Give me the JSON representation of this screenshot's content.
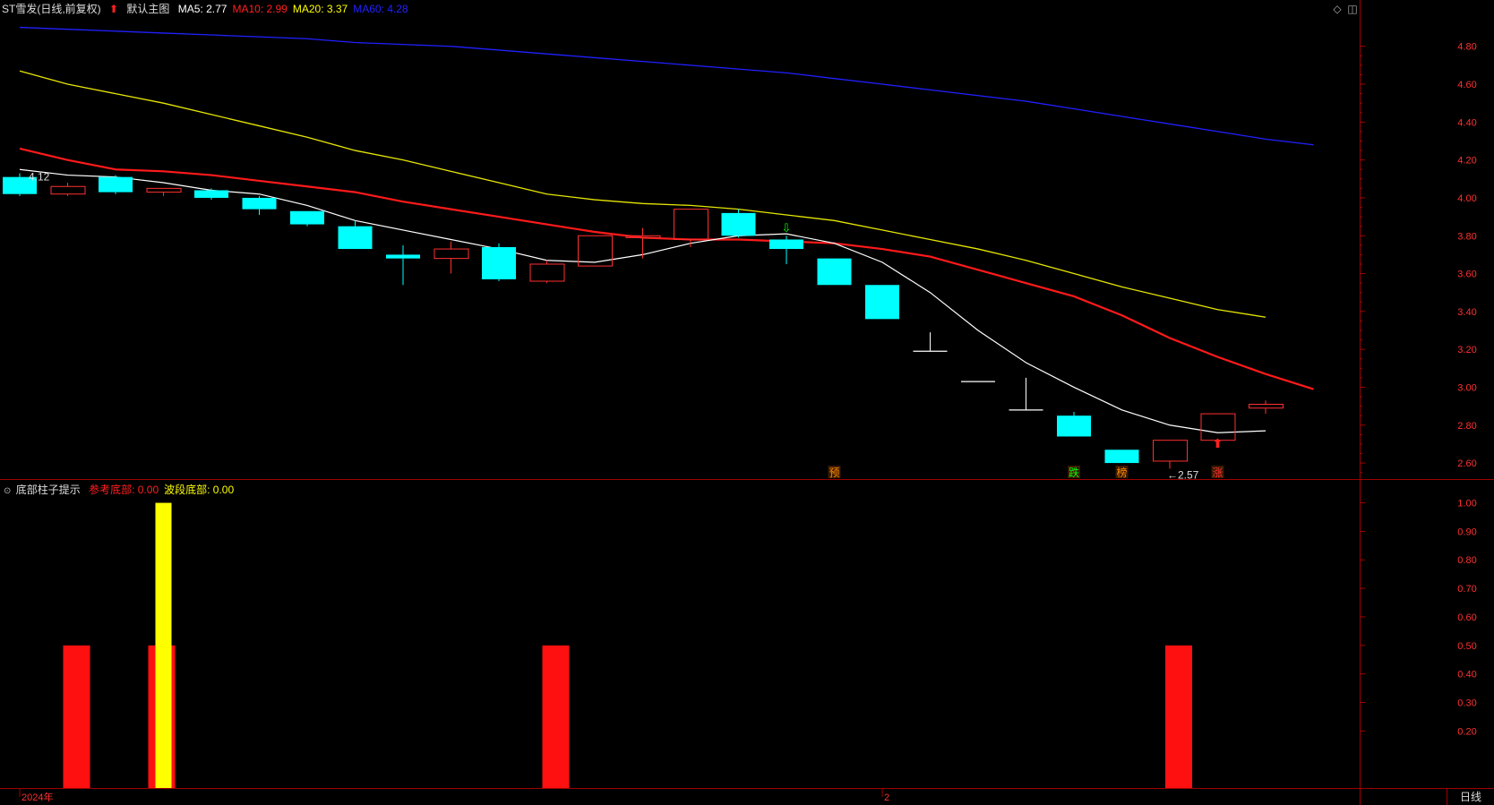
{
  "header": {
    "stock": "ST雪发",
    "adjust": "(日线,前复权)",
    "template": "默认主图",
    "ma": [
      {
        "label": "MA5:",
        "value": "2.77",
        "color": "#ffffff"
      },
      {
        "label": "MA10:",
        "value": "2.99",
        "color": "#ff2020"
      },
      {
        "label": "MA20:",
        "value": "3.37",
        "color": "#ffff00"
      },
      {
        "label": "MA60:",
        "value": "4.28",
        "color": "#2222ff"
      }
    ]
  },
  "indicator": {
    "name": "底部柱子提示",
    "items": [
      {
        "label": "参考底部:",
        "value": "0.00",
        "color": "#ff2020"
      },
      {
        "label": "波段底部:",
        "value": "0.00",
        "color": "#ffff00"
      }
    ]
  },
  "colors": {
    "up": "#ff3030",
    "down": "#00ffff",
    "axis": "#a00000",
    "ma5": "#ffffff",
    "ma10": "#ff1a1a",
    "ma20": "#e6e600",
    "ma60": "#2020ff"
  },
  "axis": {
    "price_ticks": [
      "4.80",
      "4.60",
      "4.40",
      "4.20",
      "4.00",
      "3.80",
      "3.60",
      "3.40",
      "3.20",
      "3.00",
      "2.80",
      "2.60"
    ],
    "ind_ticks": [
      "1.00",
      "0.90",
      "0.80",
      "0.70",
      "0.60",
      "0.50",
      "0.40",
      "0.30",
      "0.20"
    ],
    "date_labels": [
      {
        "text": "2024年",
        "index": 0
      },
      {
        "text": "2",
        "index": 18
      }
    ],
    "period": "日线"
  },
  "markers": {
    "high_label": "4.12",
    "low_label": "←2.57",
    "signals": [
      {
        "text": "预",
        "index": 17,
        "color": "#ff8c00"
      },
      {
        "text": "跌",
        "index": 22,
        "color": "#00ff00"
      },
      {
        "text": "榜",
        "index": 23,
        "color": "#ff8c00"
      },
      {
        "text": "涨",
        "index": 25,
        "color": "#ff3030"
      }
    ]
  },
  "chart_data": {
    "type": "candlestick",
    "candles": [
      {
        "o": 4.11,
        "h": 4.13,
        "l": 4.01,
        "c": 4.02
      },
      {
        "o": 4.02,
        "h": 4.08,
        "l": 4.01,
        "c": 4.06
      },
      {
        "o": 4.11,
        "h": 4.12,
        "l": 4.02,
        "c": 4.03
      },
      {
        "o": 4.03,
        "h": 4.05,
        "l": 4.01,
        "c": 4.05
      },
      {
        "o": 4.04,
        "h": 4.05,
        "l": 3.99,
        "c": 4.0
      },
      {
        "o": 4.0,
        "h": 4.01,
        "l": 3.91,
        "c": 3.94
      },
      {
        "o": 3.93,
        "h": 3.93,
        "l": 3.85,
        "c": 3.86
      },
      {
        "o": 3.85,
        "h": 3.88,
        "l": 3.73,
        "c": 3.73
      },
      {
        "o": 3.7,
        "h": 3.75,
        "l": 3.54,
        "c": 3.68
      },
      {
        "o": 3.68,
        "h": 3.77,
        "l": 3.6,
        "c": 3.73
      },
      {
        "o": 3.74,
        "h": 3.76,
        "l": 3.56,
        "c": 3.57
      },
      {
        "o": 3.56,
        "h": 3.67,
        "l": 3.55,
        "c": 3.65
      },
      {
        "o": 3.64,
        "h": 3.8,
        "l": 3.64,
        "c": 3.8
      },
      {
        "o": 3.79,
        "h": 3.84,
        "l": 3.68,
        "c": 3.8
      },
      {
        "o": 3.78,
        "h": 3.94,
        "l": 3.74,
        "c": 3.94
      },
      {
        "o": 3.92,
        "h": 3.94,
        "l": 3.79,
        "c": 3.8
      },
      {
        "o": 3.78,
        "h": 3.8,
        "l": 3.65,
        "c": 3.73
      },
      {
        "o": 3.68,
        "h": 3.68,
        "l": 3.54,
        "c": 3.54
      },
      {
        "o": 3.54,
        "h": 3.54,
        "l": 3.36,
        "c": 3.36
      },
      {
        "o": 3.19,
        "h": 3.29,
        "l": 3.19,
        "c": 3.19
      },
      {
        "o": 3.03,
        "h": 3.03,
        "l": 3.03,
        "c": 3.03
      },
      {
        "o": 2.88,
        "h": 3.05,
        "l": 2.88,
        "c": 2.88
      },
      {
        "o": 2.85,
        "h": 2.87,
        "l": 2.74,
        "c": 2.74
      },
      {
        "o": 2.67,
        "h": 2.67,
        "l": 2.6,
        "c": 2.6
      },
      {
        "o": 2.61,
        "h": 2.72,
        "l": 2.57,
        "c": 2.72
      },
      {
        "o": 2.72,
        "h": 2.86,
        "l": 2.72,
        "c": 2.86
      },
      {
        "o": 2.89,
        "h": 2.93,
        "l": 2.86,
        "c": 2.91
      }
    ],
    "ma5": [
      4.15,
      4.12,
      4.11,
      4.08,
      4.04,
      4.02,
      3.96,
      3.88,
      3.83,
      3.78,
      3.73,
      3.67,
      3.66,
      3.7,
      3.76,
      3.8,
      3.81,
      3.76,
      3.66,
      3.5,
      3.3,
      3.13,
      3.0,
      2.88,
      2.8,
      2.76,
      2.77
    ],
    "ma10": [
      4.26,
      4.2,
      4.15,
      4.14,
      4.12,
      4.09,
      4.06,
      4.03,
      3.98,
      3.94,
      3.9,
      3.86,
      3.82,
      3.79,
      3.78,
      3.78,
      3.77,
      3.76,
      3.73,
      3.69,
      3.62,
      3.55,
      3.48,
      3.38,
      3.26,
      3.16,
      3.07,
      2.99
    ],
    "ma20": [
      4.67,
      4.6,
      4.55,
      4.5,
      4.44,
      4.38,
      4.32,
      4.25,
      4.2,
      4.14,
      4.08,
      4.02,
      3.99,
      3.97,
      3.96,
      3.94,
      3.91,
      3.88,
      3.83,
      3.78,
      3.73,
      3.67,
      3.6,
      3.53,
      3.47,
      3.41,
      3.37
    ],
    "ma60": [
      4.9,
      4.89,
      4.88,
      4.87,
      4.86,
      4.85,
      4.84,
      4.82,
      4.81,
      4.8,
      4.78,
      4.76,
      4.74,
      4.72,
      4.7,
      4.68,
      4.66,
      4.63,
      4.6,
      4.57,
      4.54,
      4.51,
      4.47,
      4.43,
      4.39,
      4.35,
      4.31,
      4.28
    ],
    "price_range": [
      2.52,
      4.95
    ],
    "bottom_ref": [
      0,
      0.5,
      0,
      0.5,
      0,
      0,
      0,
      0,
      0,
      0,
      0,
      0.5,
      0,
      0,
      0,
      0,
      0,
      0,
      0,
      0,
      0,
      0,
      0,
      0,
      0.5,
      0,
      0
    ],
    "bottom_wave": [
      0,
      0,
      0,
      1,
      0,
      0,
      0,
      0,
      0,
      0,
      0,
      0,
      0,
      0,
      0,
      0,
      0,
      0,
      0,
      0,
      0,
      0,
      0,
      0,
      0,
      0,
      0
    ],
    "ind_range": [
      0,
      1.03
    ]
  }
}
